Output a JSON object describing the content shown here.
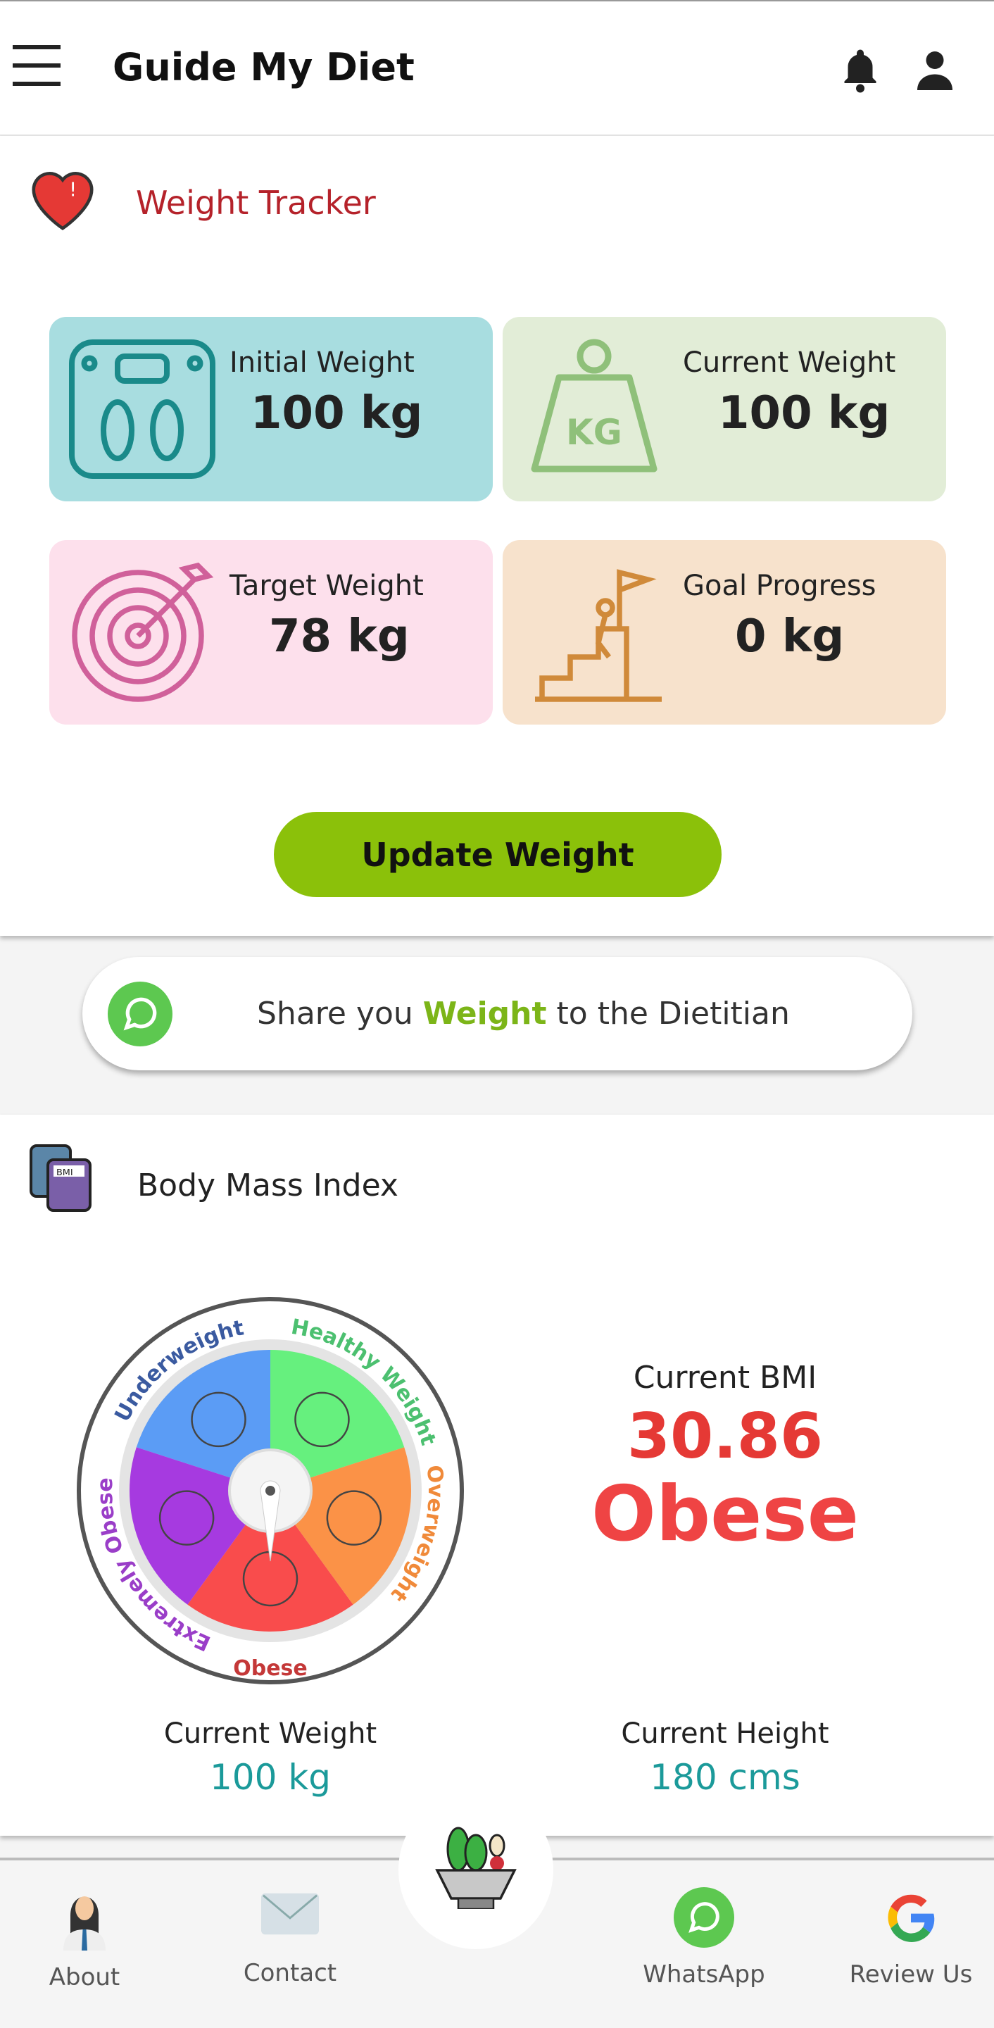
{
  "header": {
    "title": "Guide My Diet",
    "menu_icon": "hamburger-icon",
    "notification_icon": "bell-icon",
    "profile_icon": "user-icon"
  },
  "weight_tracker": {
    "title": "Weight Tracker",
    "tiles": [
      {
        "label": "Initial Weight",
        "value": "100 kg",
        "icon": "scale-icon",
        "color": "#a8dde0"
      },
      {
        "label": "Current Weight",
        "value": "100 kg",
        "icon": "kg-weight-icon",
        "color": "#e2edd7"
      },
      {
        "label": "Target Weight",
        "value": "78 kg",
        "icon": "target-icon",
        "color": "#fde0ec"
      },
      {
        "label": "Goal Progress",
        "value": "0 kg",
        "icon": "goal-climb-icon",
        "color": "#f7e2cc"
      }
    ],
    "update_button": "Update Weight",
    "accent": "#8bc10a"
  },
  "share": {
    "prefix": "Share you ",
    "highlight": "Weight",
    "suffix": " to the Dietitian"
  },
  "bmi": {
    "title": "Body Mass Index",
    "wheel_labels": [
      "Underweight",
      "Healthy Weight",
      "Overweight",
      "Obese",
      "Extremely Obese"
    ],
    "current_bmi_label": "Current BMI",
    "current_bmi": "30.86",
    "category": "Obese",
    "weight_label": "Current Weight",
    "weight_value": "100 kg",
    "height_label": "Current Height",
    "height_value": "180 cms"
  },
  "nav": {
    "about": "About",
    "contact": "Contact",
    "whatsapp": "WhatsApp",
    "review": "Review Us"
  }
}
